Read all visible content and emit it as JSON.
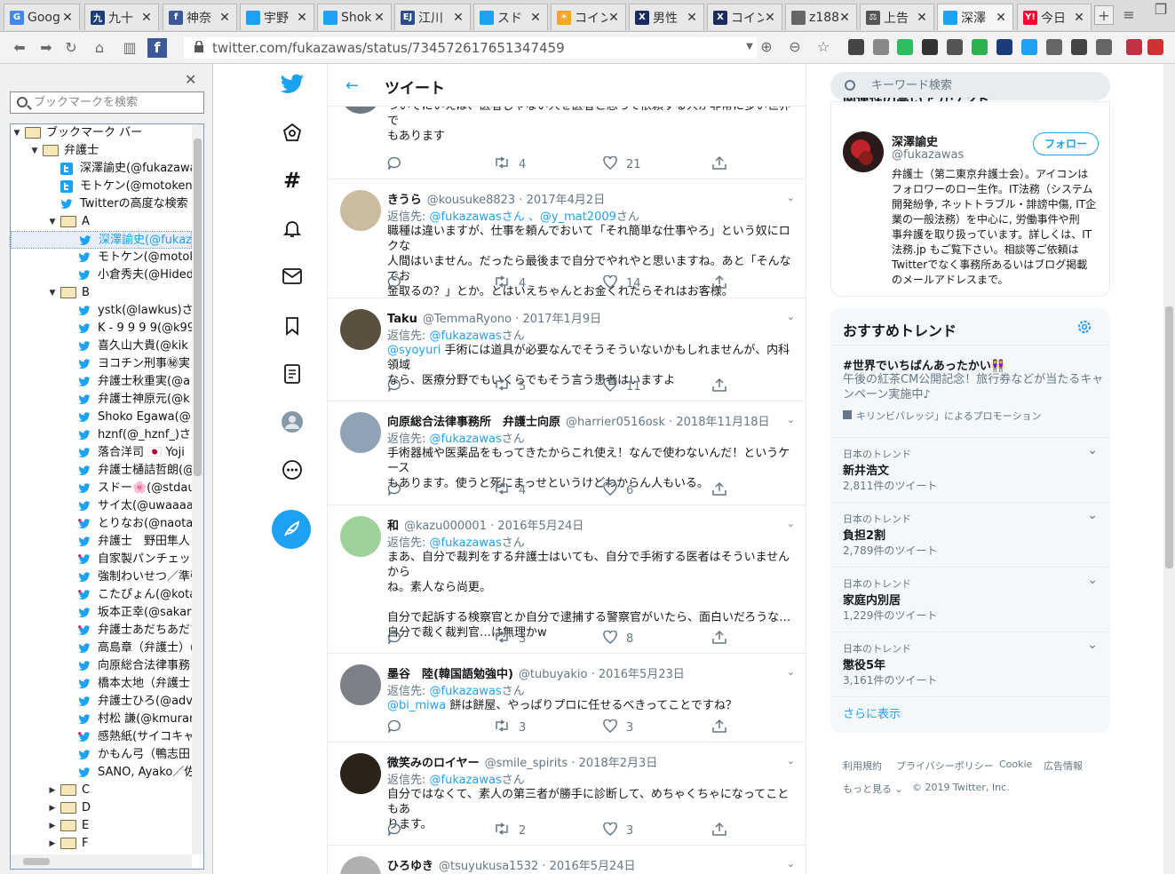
{
  "tabs": [
    {
      "label": "Goog",
      "fav_color": "#4285f4",
      "fav_text": "G"
    },
    {
      "label": "九十",
      "fav_color": "#1a3f7a",
      "fav_text": "九"
    },
    {
      "label": "神奈",
      "fav_color": "#3b5998",
      "fav_text": "f"
    },
    {
      "label": "宇野",
      "fav_color": "#1da1f2",
      "fav_text": ""
    },
    {
      "label": "Shok",
      "fav_color": "#1da1f2",
      "fav_text": ""
    },
    {
      "label": "江川",
      "fav_color": "#2c4b8a",
      "fav_text": "EJ"
    },
    {
      "label": "スド",
      "fav_color": "#1da1f2",
      "fav_text": ""
    },
    {
      "label": "コイン",
      "fav_color": "#f5a623",
      "fav_text": "☀"
    },
    {
      "label": "男性",
      "fav_color": "#1a2b5e",
      "fav_text": "X"
    },
    {
      "label": "コイン",
      "fav_color": "#1a2b5e",
      "fav_text": "X"
    },
    {
      "label": "z188",
      "fav_color": "#666666",
      "fav_text": ""
    },
    {
      "label": "上告",
      "fav_color": "#555555",
      "fav_text": "⚖"
    },
    {
      "label": "深澤",
      "fav_color": "#1da1f2",
      "fav_text": ""
    },
    {
      "label": "今日",
      "fav_color": "#ff0033",
      "fav_text": "Y!"
    }
  ],
  "url": "twitter.com/fukazawas/status/734572617651347459",
  "sidebar": {
    "search_placeholder": "ブックマークを検索",
    "rows": [
      {
        "label": "ブックマーク バー",
        "type": "folder",
        "level": 0,
        "open": true
      },
      {
        "label": "弁護士",
        "type": "folder",
        "level": 1,
        "open": true
      },
      {
        "label": "深澤諭史(@fukazawa",
        "type": "tw-box",
        "level": 2
      },
      {
        "label": "モトケン(@motoken_",
        "type": "tw-box",
        "level": 2
      },
      {
        "label": "Twitterの高度な検索",
        "type": "tw",
        "level": 2
      },
      {
        "label": "A",
        "type": "folder",
        "level": 2,
        "open": true
      },
      {
        "label": "深澤諭史(@fukaz",
        "type": "tw",
        "level": 3,
        "selected": true
      },
      {
        "label": "モトケン(@motok",
        "type": "tw",
        "level": 3
      },
      {
        "label": "小倉秀夫(@Hided",
        "type": "tw",
        "level": 3
      },
      {
        "label": "B",
        "type": "folder",
        "level": 2,
        "open": true
      },
      {
        "label": "ystk(@lawkus)さん",
        "type": "tw",
        "level": 3
      },
      {
        "label": "K - 9 9 9 9(@k99",
        "type": "tw",
        "level": 3
      },
      {
        "label": "喜久山大貴(@kik",
        "type": "tw",
        "level": 3
      },
      {
        "label": "ヨコチン刑事㊙実",
        "type": "tw",
        "level": 3
      },
      {
        "label": "弁護士秋重実(@a",
        "type": "tw",
        "level": 3
      },
      {
        "label": "弁護士神原元(@k",
        "type": "tw",
        "level": 3
      },
      {
        "label": "Shoko Egawa(@",
        "type": "tw",
        "level": 3
      },
      {
        "label": "hznf(@_hznf_)さん",
        "type": "tw",
        "level": 3
      },
      {
        "label": "落合洋司 🇯🇵 Yoji",
        "type": "tw",
        "level": 3
      },
      {
        "label": "弁護士樋詰哲朗(@",
        "type": "tw",
        "level": 3
      },
      {
        "label": "スドー🌸(@stdau",
        "type": "tw",
        "level": 3
      },
      {
        "label": "サイ太(@uwaaaa)",
        "type": "tw",
        "level": 3
      },
      {
        "label": "とりなお(@naotar",
        "type": "tw-red",
        "level": 3
      },
      {
        "label": "弁護士　野田隼人",
        "type": "tw",
        "level": 3
      },
      {
        "label": "自家製パンチェッタ",
        "type": "tw-red",
        "level": 3
      },
      {
        "label": "強制わいせつ／準強",
        "type": "tw",
        "level": 3
      },
      {
        "label": "こたぴょん(@kotac",
        "type": "tw-red",
        "level": 3
      },
      {
        "label": "坂本正幸(@sakar",
        "type": "tw",
        "level": 3
      },
      {
        "label": "弁護士あだちあだち",
        "type": "tw-red",
        "level": 3
      },
      {
        "label": "高島章（弁護士）(@",
        "type": "tw",
        "level": 3
      },
      {
        "label": "向原総合法律事務",
        "type": "tw",
        "level": 3
      },
      {
        "label": "橋本太地（弁護士",
        "type": "tw",
        "level": 3
      },
      {
        "label": "弁護士ひろ(@adv",
        "type": "tw",
        "level": 3
      },
      {
        "label": "村松 謙(@kmuran",
        "type": "tw",
        "level": 3
      },
      {
        "label": "感熱紙(サイコキャ",
        "type": "tw-red",
        "level": 3
      },
      {
        "label": "かもん弓（鴨志田",
        "type": "tw",
        "level": 3
      },
      {
        "label": "SANO, Ayako／佐",
        "type": "tw",
        "level": 3
      },
      {
        "label": "C",
        "type": "folder",
        "level": 2,
        "open": false
      },
      {
        "label": "D",
        "type": "folder",
        "level": 2,
        "open": false
      },
      {
        "label": "E",
        "type": "folder",
        "level": 2,
        "open": false
      },
      {
        "label": "F",
        "type": "folder",
        "level": 2,
        "open": false
      }
    ]
  },
  "main": {
    "title": "ツイート",
    "tweets": [
      {
        "name": "",
        "handle": "",
        "date": "",
        "reply_prefix": "返信先: ",
        "reply_to": "@fukazawas",
        "reply_suffix": "さん",
        "body": "ついでにいえば、医者じゃない人を医者と思って依頼する人が非常に多い世界で\nもあります",
        "retweets": "4",
        "likes": "21",
        "avatar": "#6d7a84"
      },
      {
        "name": "きうら",
        "handle": "@kousuke8823",
        "date": "2017年4月2日",
        "reply_prefix": "返信先: ",
        "reply_to": "@fukazawasさん 、@y_mat2009",
        "reply_suffix": "さん",
        "body": "職種は違いますが、仕事を頼んでおいて「それ簡単な仕事やろ」という奴にロクな\n人間はいません。だったら最後まで自分でやれやと思いますね。あと「そんなでお\n金取るの？」とか。とはいえちゃんとお金くれたらそれはお客様。",
        "retweets": "4",
        "likes": "14",
        "avatar": "#c9bca0"
      },
      {
        "name": "Taku",
        "handle": "@TemmaRyono",
        "date": "2017年1月9日",
        "reply_prefix": "返信先: ",
        "reply_to": "@fukazawas",
        "reply_suffix": "さん",
        "mention": "@syoyuri",
        "body": " 手術には道具が必要なんでそうそういないかもしれませんが、内科領域\nなら、医療分野でもいくらでもそう言う患者はいますよ",
        "retweets": "5",
        "likes": "11",
        "avatar": "#5a5040"
      },
      {
        "name": "向原総合法律事務所　弁護士向原",
        "handle": "@harrier0516osk",
        "date": "2018年11月18日",
        "reply_prefix": "返信先: ",
        "reply_to": "@fukazawas",
        "reply_suffix": "さん",
        "body": "手術器械や医薬品をもってきたからこれ使え！なんで使わないんだ！というケース\nもあります。使うと死にまっせというけどわからん人もいる。",
        "retweets": "4",
        "likes": "6",
        "avatar": "#8fa3b5"
      },
      {
        "name": "和",
        "handle": "@kazu000001",
        "date": "2016年5月24日",
        "reply_prefix": "返信先: ",
        "reply_to": "@fukazawas",
        "reply_suffix": "さん",
        "body": "まあ、自分で裁判をする弁護士はいても、自分で手術する医者はそういませんから\nね。素人なら尚更。\n\n自分で起訴する検察官とか自分で逮捕する警察官がいたら、面白いだろうな…\n自分で裁く裁判官…は無理かw",
        "retweets": "3",
        "likes": "8",
        "avatar": "#9ed29a"
      },
      {
        "name": "墨谷　陸(韓国語勉強中)",
        "handle": "@tubuyakio",
        "date": "2016年5月23日",
        "reply_prefix": "返信先: ",
        "reply_to": "@fukazawas",
        "reply_suffix": "さん",
        "mention": "@bi_miwa",
        "body": " 餅は餅屋、やっぱりプロに任せるべきってことですね？",
        "retweets": "3",
        "likes": "3",
        "avatar": "#7d8088"
      },
      {
        "name": "微笑みのロイヤー",
        "handle": "@smile_spirits",
        "date": "2018年2月3日",
        "reply_prefix": "返信先: ",
        "reply_to": "@fukazawas",
        "reply_suffix": "さん",
        "body": "自分ではなくて、素人の第三者が勝手に診断して、めちゃくちゃになってこともあ\nります。",
        "retweets": "2",
        "likes": "3",
        "avatar": "#2a2418"
      },
      {
        "name": "ひろゆき",
        "handle": "@tsuyukusa1532",
        "date": "2016年5月24日",
        "reply_prefix": "",
        "reply_to": "",
        "reply_suffix": "",
        "body": "",
        "retweets": "",
        "likes": "",
        "avatar": "#b0b0b0"
      }
    ]
  },
  "right": {
    "search_placeholder": "キーワード検索",
    "related_header": "関連性の高いアカウント",
    "account": {
      "name": "深澤諭史",
      "handle": "@fukazawas",
      "follow_label": "フォロー",
      "bio": "弁護士（第二東京弁護士会）。アイコンは\nフォロワーのロー生作。IT法務（システム\n開発紛争, ネットトラブル・誹謗中傷, IT企\n業の一般法務）を中心に, 労働事件や刑\n事弁護を取り扱っています。詳しくは、IT\n法務.jp もご覧下さい。相談等ご依頼は\nTwitterでなく事務所あるいはブログ掲載\nのメールアドレスまで。"
    },
    "trends_title": "おすすめトレンド",
    "promo": {
      "tag": "#世界でいちばんあったかい👭",
      "text": "午後の紅茶CM公開記念！旅行券などが当たるキャ\nンペーン実施中♪",
      "by": "キリンビバレッジ」によるプロモーション"
    },
    "trends": [
      {
        "context": "日本のトレンド",
        "name": "新井浩文",
        "count": "2,811件のツイート"
      },
      {
        "context": "日本のトレンド",
        "name": "負担2割",
        "count": "2,789件のツイート"
      },
      {
        "context": "日本のトレンド",
        "name": "家庭内別居",
        "count": "1,229件のツイート"
      },
      {
        "context": "日本のトレンド",
        "name": "懲役5年",
        "count": "3,161件のツイート"
      }
    ],
    "show_more": "さらに表示",
    "footer": {
      "terms": "利用規約",
      "privacy": "プライバシーポリシー",
      "cookie": "Cookie",
      "ads": "広告情報",
      "more": "もっと見る",
      "copyright": "© 2019 Twitter, Inc."
    }
  },
  "colors": {
    "twitter_blue": "#1da1f2",
    "gray_text": "#657786"
  }
}
